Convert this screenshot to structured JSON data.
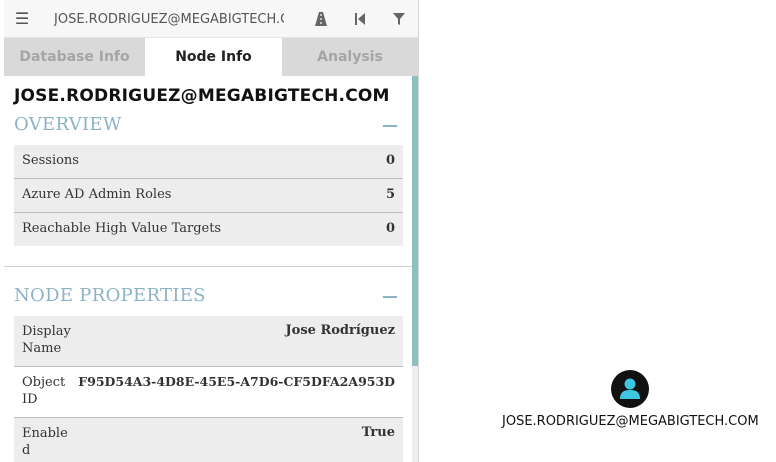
{
  "topbar": {
    "search_value": "JOSE.RODRIGUEZ@MEGABIGTECH.COM",
    "icons": [
      "menu-icon",
      "pathfinding-icon",
      "back-icon",
      "filter-icon"
    ]
  },
  "tabs": [
    {
      "label": "Database Info",
      "active": false
    },
    {
      "label": "Node Info",
      "active": true
    },
    {
      "label": "Analysis",
      "active": false
    }
  ],
  "node": {
    "title": "JOSE.RODRIGUEZ@MEGABIGTECH.COM"
  },
  "overview": {
    "title": "OVERVIEW",
    "rows": [
      {
        "label": "Sessions",
        "value": "0"
      },
      {
        "label": "Azure AD Admin Roles",
        "value": "5"
      },
      {
        "label": "Reachable High Value Targets",
        "value": "0"
      }
    ]
  },
  "properties": {
    "title": "NODE PROPERTIES",
    "rows": [
      {
        "label": "Display Name",
        "value": "Jose Rodríguez"
      },
      {
        "label": "Object ID",
        "value": "F95D54A3-4D8E-45E5-A7D6-CF5DFA2A953D"
      },
      {
        "label": "Enabled",
        "value": "True"
      }
    ]
  },
  "graph": {
    "node_label": "JOSE.RODRIGUEZ@MEGABIGTECH.COM",
    "node_icon": "user-icon",
    "node_color": "#111111",
    "icon_color": "#3ec6e0"
  },
  "colors": {
    "section_title": "#8cb2c6",
    "scrollbar": "#8fc0c0",
    "tab_inactive_bg": "#d9d9d9"
  }
}
